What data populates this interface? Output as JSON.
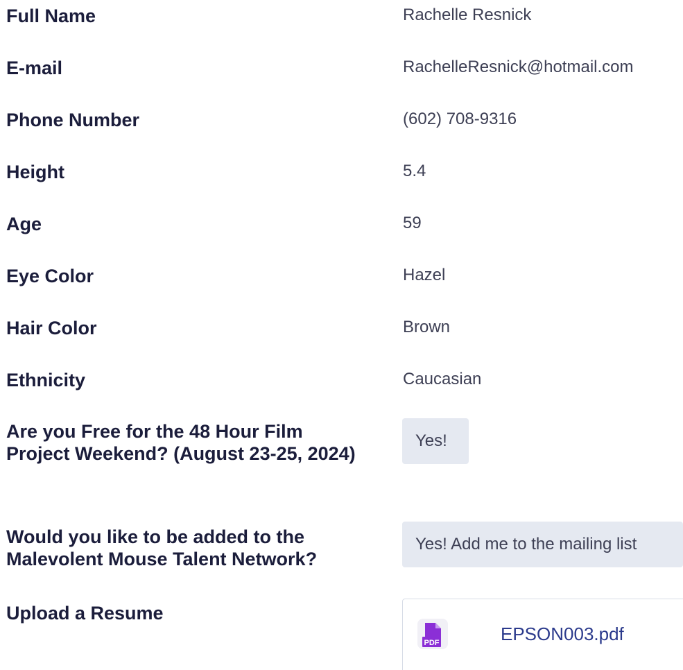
{
  "fields": [
    {
      "label": "Full Name",
      "value": "Rachelle Resnick"
    },
    {
      "label": "E-mail",
      "value": "RachelleResnick@hotmail.com"
    },
    {
      "label": "Phone Number",
      "value": "(602) 708-9316"
    },
    {
      "label": "Height",
      "value": "5.4"
    },
    {
      "label": "Age",
      "value": "59"
    },
    {
      "label": "Eye Color",
      "value": "Hazel"
    },
    {
      "label": "Hair Color",
      "value": "Brown"
    },
    {
      "label": "Ethnicity",
      "value": "Caucasian"
    }
  ],
  "weekend_question": {
    "label": "Are you Free for the 48 Hour Film Project Weekend? (August 23-25, 2024)",
    "value": "Yes!"
  },
  "network_question": {
    "label": "Would you like to be added to the Malevolent Mouse Talent Network?",
    "value": "Yes! Add me to the mailing list"
  },
  "resume": {
    "label": "Upload a Resume",
    "file_name": "EPSON003.pdf",
    "icon": "pdf-file-icon",
    "icon_text": "PDF"
  },
  "colors": {
    "label_text": "#1b1d3b",
    "value_text": "#3d3f54",
    "chip_background": "#e5e9f1",
    "file_link": "#2b3a8c",
    "pdf_icon": "#8b2fd6"
  }
}
